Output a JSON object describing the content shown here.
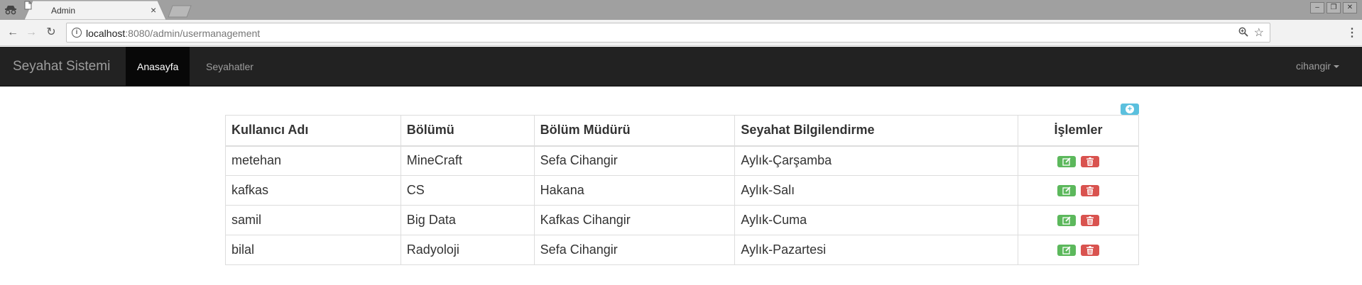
{
  "browser": {
    "tab_title": "Admin",
    "tab_close": "×",
    "url_host": "localhost",
    "url_rest": ":8080/admin/usermanagement"
  },
  "navbar": {
    "brand": "Seyahat Sistemi",
    "items": [
      {
        "label": "Anasayfa",
        "active": true
      },
      {
        "label": "Seyahatler",
        "active": false
      }
    ],
    "user": "cihangir"
  },
  "table": {
    "headers": [
      "Kullanıcı Adı",
      "Bölümü",
      "Bölüm Müdürü",
      "Seyahat Bilgilendirme",
      "İşlemler"
    ],
    "rows": [
      [
        "metehan",
        "MineCraft",
        "Sefa Cihangir",
        "Aylık-Çarşamba"
      ],
      [
        "kafkas",
        "CS",
        "Hakana",
        "Aylık-Salı"
      ],
      [
        "samil",
        "Big Data",
        "Kafkas Cihangir",
        "Aylık-Cuma"
      ],
      [
        "bilal",
        "Radyoloji",
        "Sefa Cihangir",
        "Aylık-Pazartesi"
      ]
    ]
  },
  "colors": {
    "navbar_bg": "#222222",
    "edit_button": "#5cb85c",
    "delete_button": "#d9534f",
    "add_button": "#5bc0de"
  }
}
